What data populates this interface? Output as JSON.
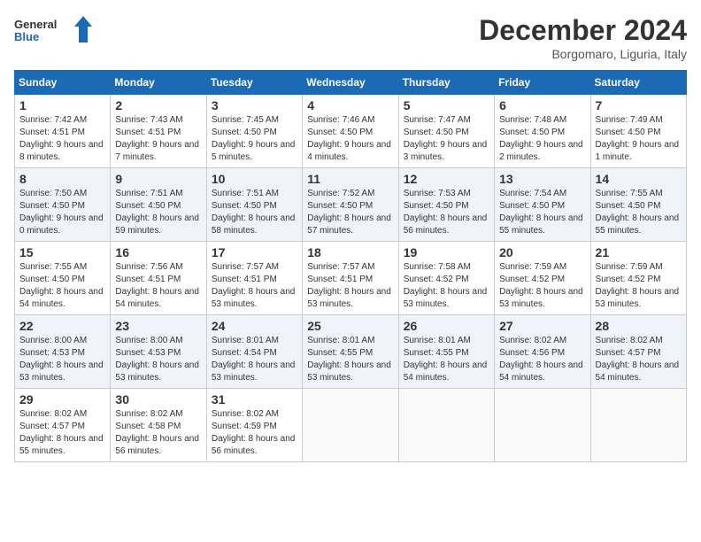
{
  "header": {
    "logo_line1": "General",
    "logo_line2": "Blue",
    "month": "December 2024",
    "location": "Borgomaro, Liguria, Italy"
  },
  "weekdays": [
    "Sunday",
    "Monday",
    "Tuesday",
    "Wednesday",
    "Thursday",
    "Friday",
    "Saturday"
  ],
  "weeks": [
    [
      {
        "day": "1",
        "info": "Sunrise: 7:42 AM\nSunset: 4:51 PM\nDaylight: 9 hours and 8 minutes."
      },
      {
        "day": "2",
        "info": "Sunrise: 7:43 AM\nSunset: 4:51 PM\nDaylight: 9 hours and 7 minutes."
      },
      {
        "day": "3",
        "info": "Sunrise: 7:45 AM\nSunset: 4:50 PM\nDaylight: 9 hours and 5 minutes."
      },
      {
        "day": "4",
        "info": "Sunrise: 7:46 AM\nSunset: 4:50 PM\nDaylight: 9 hours and 4 minutes."
      },
      {
        "day": "5",
        "info": "Sunrise: 7:47 AM\nSunset: 4:50 PM\nDaylight: 9 hours and 3 minutes."
      },
      {
        "day": "6",
        "info": "Sunrise: 7:48 AM\nSunset: 4:50 PM\nDaylight: 9 hours and 2 minutes."
      },
      {
        "day": "7",
        "info": "Sunrise: 7:49 AM\nSunset: 4:50 PM\nDaylight: 9 hours and 1 minute."
      }
    ],
    [
      {
        "day": "8",
        "info": "Sunrise: 7:50 AM\nSunset: 4:50 PM\nDaylight: 9 hours and 0 minutes."
      },
      {
        "day": "9",
        "info": "Sunrise: 7:51 AM\nSunset: 4:50 PM\nDaylight: 8 hours and 59 minutes."
      },
      {
        "day": "10",
        "info": "Sunrise: 7:51 AM\nSunset: 4:50 PM\nDaylight: 8 hours and 58 minutes."
      },
      {
        "day": "11",
        "info": "Sunrise: 7:52 AM\nSunset: 4:50 PM\nDaylight: 8 hours and 57 minutes."
      },
      {
        "day": "12",
        "info": "Sunrise: 7:53 AM\nSunset: 4:50 PM\nDaylight: 8 hours and 56 minutes."
      },
      {
        "day": "13",
        "info": "Sunrise: 7:54 AM\nSunset: 4:50 PM\nDaylight: 8 hours and 55 minutes."
      },
      {
        "day": "14",
        "info": "Sunrise: 7:55 AM\nSunset: 4:50 PM\nDaylight: 8 hours and 55 minutes."
      }
    ],
    [
      {
        "day": "15",
        "info": "Sunrise: 7:55 AM\nSunset: 4:50 PM\nDaylight: 8 hours and 54 minutes."
      },
      {
        "day": "16",
        "info": "Sunrise: 7:56 AM\nSunset: 4:51 PM\nDaylight: 8 hours and 54 minutes."
      },
      {
        "day": "17",
        "info": "Sunrise: 7:57 AM\nSunset: 4:51 PM\nDaylight: 8 hours and 53 minutes."
      },
      {
        "day": "18",
        "info": "Sunrise: 7:57 AM\nSunset: 4:51 PM\nDaylight: 8 hours and 53 minutes."
      },
      {
        "day": "19",
        "info": "Sunrise: 7:58 AM\nSunset: 4:52 PM\nDaylight: 8 hours and 53 minutes."
      },
      {
        "day": "20",
        "info": "Sunrise: 7:59 AM\nSunset: 4:52 PM\nDaylight: 8 hours and 53 minutes."
      },
      {
        "day": "21",
        "info": "Sunrise: 7:59 AM\nSunset: 4:52 PM\nDaylight: 8 hours and 53 minutes."
      }
    ],
    [
      {
        "day": "22",
        "info": "Sunrise: 8:00 AM\nSunset: 4:53 PM\nDaylight: 8 hours and 53 minutes."
      },
      {
        "day": "23",
        "info": "Sunrise: 8:00 AM\nSunset: 4:53 PM\nDaylight: 8 hours and 53 minutes."
      },
      {
        "day": "24",
        "info": "Sunrise: 8:01 AM\nSunset: 4:54 PM\nDaylight: 8 hours and 53 minutes."
      },
      {
        "day": "25",
        "info": "Sunrise: 8:01 AM\nSunset: 4:55 PM\nDaylight: 8 hours and 53 minutes."
      },
      {
        "day": "26",
        "info": "Sunrise: 8:01 AM\nSunset: 4:55 PM\nDaylight: 8 hours and 54 minutes."
      },
      {
        "day": "27",
        "info": "Sunrise: 8:02 AM\nSunset: 4:56 PM\nDaylight: 8 hours and 54 minutes."
      },
      {
        "day": "28",
        "info": "Sunrise: 8:02 AM\nSunset: 4:57 PM\nDaylight: 8 hours and 54 minutes."
      }
    ],
    [
      {
        "day": "29",
        "info": "Sunrise: 8:02 AM\nSunset: 4:57 PM\nDaylight: 8 hours and 55 minutes."
      },
      {
        "day": "30",
        "info": "Sunrise: 8:02 AM\nSunset: 4:58 PM\nDaylight: 8 hours and 56 minutes."
      },
      {
        "day": "31",
        "info": "Sunrise: 8:02 AM\nSunset: 4:59 PM\nDaylight: 8 hours and 56 minutes."
      },
      null,
      null,
      null,
      null
    ]
  ]
}
